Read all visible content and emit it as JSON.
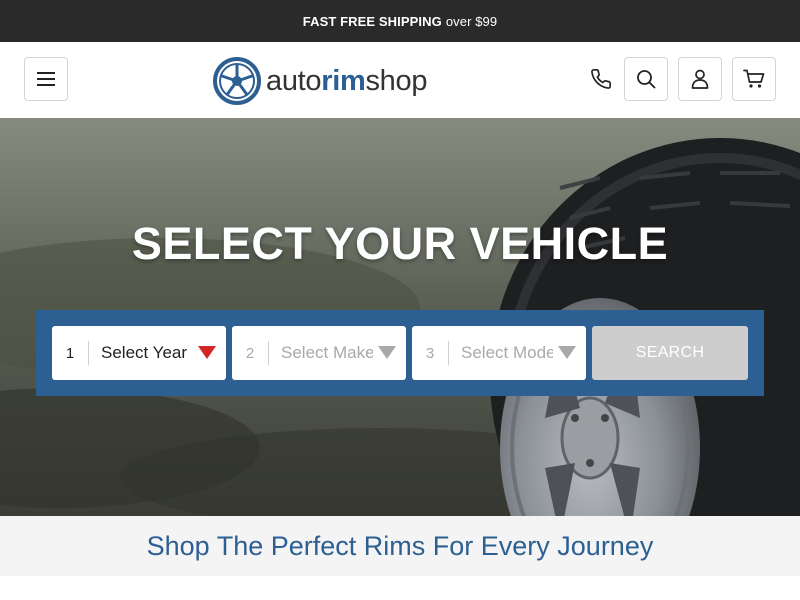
{
  "announcement": {
    "strong": "FAST FREE SHIPPING",
    "rest": "over $99"
  },
  "header": {
    "logo": {
      "part1": "auto",
      "part2": "rim",
      "part3": "shop"
    },
    "icons": {
      "menu": "menu-icon",
      "phone": "phone-icon",
      "search": "search-icon",
      "account": "user-icon",
      "cart": "cart-icon"
    }
  },
  "hero": {
    "title": "SELECT YOUR VEHICLE",
    "selects": [
      {
        "num": "1",
        "label": "Select Year",
        "enabled": true
      },
      {
        "num": "2",
        "label": "Select Make",
        "enabled": false
      },
      {
        "num": "3",
        "label": "Select Model",
        "enabled": false
      }
    ],
    "search_label": "SEARCH"
  },
  "tagline": "Shop The Perfect Rims For Every Journey",
  "colors": {
    "brand": "#2d5f93",
    "topbar": "#2a2a2a",
    "arrow_active": "#d42626",
    "disabled": "#cdcdcd"
  }
}
